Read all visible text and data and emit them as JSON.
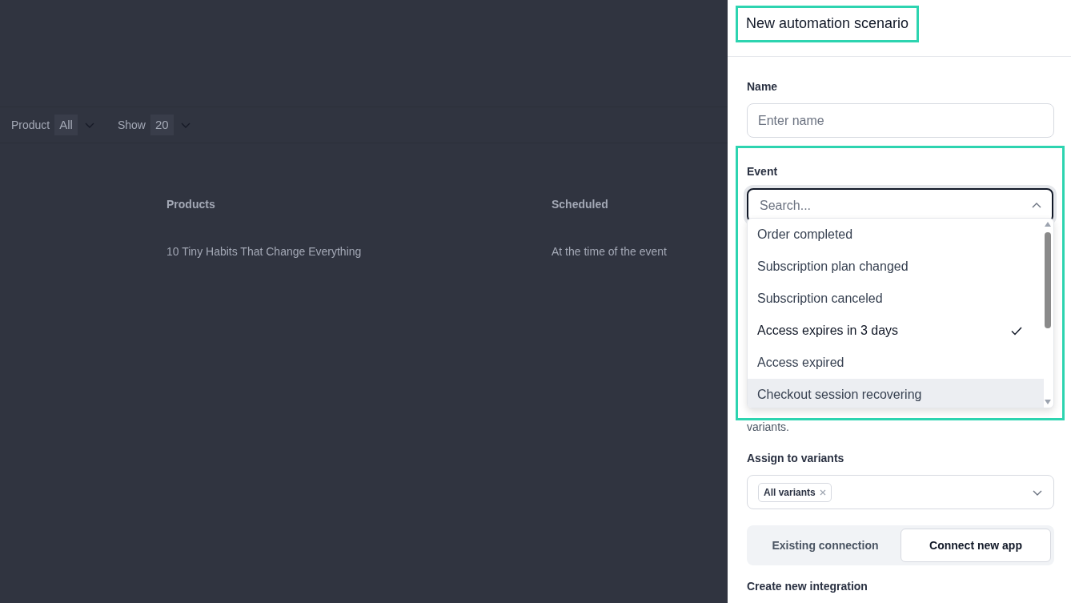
{
  "background_page": {
    "filters": [
      {
        "label": "Product",
        "value": "All"
      },
      {
        "label": "Show",
        "value": "20"
      }
    ],
    "table": {
      "columns": [
        "Products",
        "Scheduled"
      ],
      "rows": [
        [
          "10 Tiny Habits That Change Everything",
          "At the time of the event"
        ]
      ]
    }
  },
  "panel": {
    "title": "New automation scenario",
    "name_field": {
      "label": "Name",
      "placeholder": "Enter name"
    },
    "event_field": {
      "label": "Event",
      "placeholder": "Search...",
      "expanded": true,
      "options": [
        {
          "label": "Order completed",
          "selected": false,
          "hovered": false
        },
        {
          "label": "Subscription plan changed",
          "selected": false,
          "hovered": false
        },
        {
          "label": "Subscription canceled",
          "selected": false,
          "hovered": false
        },
        {
          "label": "Access expires in 3 days",
          "selected": true,
          "hovered": false
        },
        {
          "label": "Access expired",
          "selected": false,
          "hovered": false
        },
        {
          "label": "Checkout session recovering",
          "selected": false,
          "hovered": true
        }
      ]
    },
    "hint": "variants.",
    "variants_field": {
      "label": "Assign to variants",
      "tags": [
        "All variants"
      ]
    },
    "segments": [
      {
        "label": "Existing connection",
        "selected": false
      },
      {
        "label": "Connect new app",
        "selected": true
      }
    ],
    "section_title": "Create new integration"
  }
}
